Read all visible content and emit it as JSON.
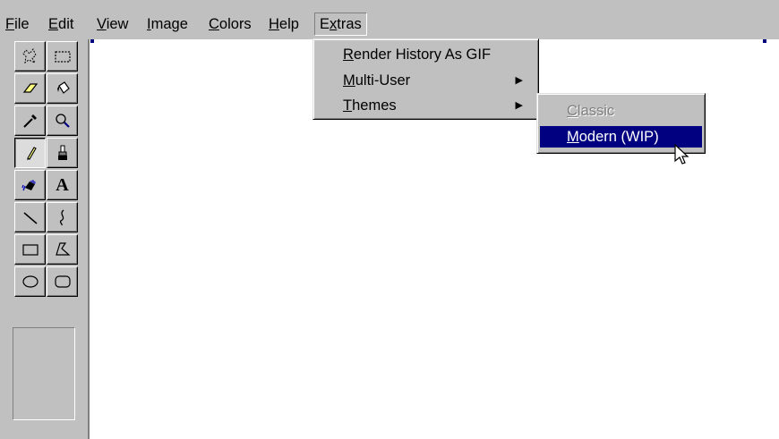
{
  "menubar": {
    "items": [
      {
        "mnemonic": "F",
        "rest": "ile"
      },
      {
        "mnemonic": "E",
        "rest": "dit"
      },
      {
        "mnemonic": "V",
        "rest": "iew"
      },
      {
        "mnemonic": "I",
        "rest": "mage"
      },
      {
        "mnemonic": "C",
        "rest": "olors"
      },
      {
        "mnemonic": "H",
        "rest": "elp"
      }
    ],
    "extras": {
      "pre": "E",
      "mnemonic": "x",
      "rest": "tras"
    }
  },
  "extras_menu": {
    "items": [
      {
        "mnemonic": "R",
        "rest": "ender History As GIF"
      },
      {
        "mnemonic": "M",
        "rest": "ulti-User",
        "arrow": "▶"
      },
      {
        "mnemonic": "T",
        "rest": "hemes",
        "arrow": "▶"
      }
    ]
  },
  "themes_menu": {
    "items": [
      {
        "mnemonic": "C",
        "rest": "lassic",
        "state": "disabled"
      },
      {
        "mnemonic": "M",
        "rest": "odern (WIP)",
        "state": "selected"
      }
    ]
  },
  "toolbox": {
    "tools": [
      "free-form-select-icon",
      "rect-select-icon",
      "eraser-icon",
      "fill-bucket-icon",
      "pick-color-icon",
      "magnifier-icon",
      "pencil-icon",
      "brush-icon",
      "airbrush-icon",
      "text-icon",
      "line-icon",
      "curve-icon",
      "rectangle-icon",
      "polygon-icon",
      "ellipse-icon",
      "rounded-rect-icon"
    ],
    "text_tool_glyph": "A",
    "active_tool": "pencil-icon"
  },
  "colors": {
    "face": "#c0c0c0",
    "highlight": "#000080",
    "canvas": "#ffffff"
  }
}
